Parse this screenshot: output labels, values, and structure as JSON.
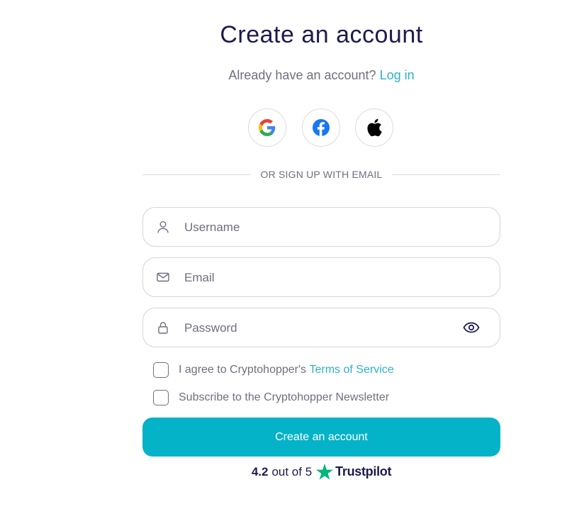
{
  "header": {
    "title": "Create an account",
    "login_prompt": "Already have an account?",
    "login_link": "Log in"
  },
  "social": {
    "google": "google-icon",
    "facebook": "facebook-icon",
    "apple": "apple-icon"
  },
  "divider_text": "OR SIGN UP WITH EMAIL",
  "form": {
    "username_placeholder": "Username",
    "email_placeholder": "Email",
    "password_placeholder": "Password",
    "terms_text": "I agree to Cryptohopper's",
    "terms_link": "Terms of Service",
    "newsletter_text": "Subscribe to the Cryptohopper Newsletter",
    "submit_label": "Create an account"
  },
  "rating": {
    "score": "4.2",
    "suffix": "out of 5",
    "brand": "Trustpilot"
  },
  "colors": {
    "accent": "#04b3c8",
    "link": "#2cb3c9",
    "heading": "#1e1b4e",
    "trustpilot_star": "#00b67a"
  }
}
